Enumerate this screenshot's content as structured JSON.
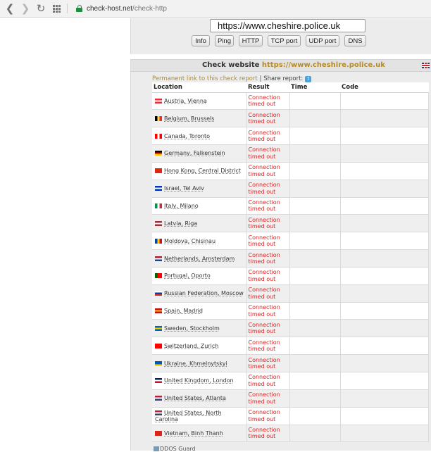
{
  "browser": {
    "url_domain": "check-host.net",
    "url_path": "/check-http"
  },
  "form": {
    "url_value": "https://www.cheshire.police.uk",
    "tabs": [
      {
        "label": "Info",
        "w": 26
      },
      {
        "label": "Ping",
        "w": 27
      },
      {
        "label": "HTTP",
        "w": 34
      },
      {
        "label": "TCP port",
        "w": 47
      },
      {
        "label": "UDP port",
        "w": 48
      },
      {
        "label": "DNS",
        "w": 31
      }
    ]
  },
  "results": {
    "title_prefix": "Check website",
    "title_url": "https://www.cheshire.police.uk",
    "permanent_link": "Permanent link to this check report",
    "share_label": "| Share report:",
    "columns": [
      "Location",
      "Result",
      "Time",
      "Code"
    ],
    "rows": [
      {
        "location": "Austria, Vienna",
        "flag": [
          "#ed2939",
          "#ffffff",
          "#ed2939"
        ],
        "flag_dir": "h",
        "result": "Connection timed out"
      },
      {
        "location": "Belgium, Brussels",
        "flag": [
          "#000000",
          "#fae042",
          "#ed2939"
        ],
        "flag_dir": "v",
        "result": "Connection timed out"
      },
      {
        "location": "Canada, Toronto",
        "flag": [
          "#ff0000",
          "#ffffff",
          "#ff0000"
        ],
        "flag_dir": "v",
        "result": "Connection timed out"
      },
      {
        "location": "Germany, Falkenstein",
        "flag": [
          "#000000",
          "#dd0000",
          "#ffce00"
        ],
        "flag_dir": "h",
        "result": "Connection timed out"
      },
      {
        "location": "Hong Kong, Central District",
        "flag": [
          "#de2910",
          "#de2910",
          "#de2910"
        ],
        "flag_dir": "h",
        "result": "Connection timed out"
      },
      {
        "location": "Israel, Tel Aviv",
        "flag": [
          "#0038b8",
          "#ffffff",
          "#0038b8"
        ],
        "flag_dir": "h",
        "result": "Connection timed out"
      },
      {
        "location": "Italy, Milano",
        "flag": [
          "#009246",
          "#ffffff",
          "#ce2b37"
        ],
        "flag_dir": "v",
        "result": "Connection timed out"
      },
      {
        "location": "Latvia, Riga",
        "flag": [
          "#9e3039",
          "#ffffff",
          "#9e3039"
        ],
        "flag_dir": "h",
        "result": "Connection timed out"
      },
      {
        "location": "Moldova, Chisinau",
        "flag": [
          "#0046ae",
          "#ffd200",
          "#cc092f"
        ],
        "flag_dir": "v",
        "result": "Connection timed out"
      },
      {
        "location": "Netherlands, Amsterdam",
        "flag": [
          "#ae1c28",
          "#ffffff",
          "#21468b"
        ],
        "flag_dir": "h",
        "result": "Connection timed out"
      },
      {
        "location": "Portugal, Oporto",
        "flag": [
          "#006600",
          "#ff0000",
          "#ff0000"
        ],
        "flag_dir": "v",
        "result": "Connection timed out"
      },
      {
        "location": "Russian Federation, Moscow",
        "flag": [
          "#ffffff",
          "#0039a6",
          "#d52b1e"
        ],
        "flag_dir": "h",
        "result": "Connection timed out"
      },
      {
        "location": "Spain, Madrid",
        "flag": [
          "#c60b1e",
          "#ffc400",
          "#c60b1e"
        ],
        "flag_dir": "h",
        "result": "Connection timed out"
      },
      {
        "location": "Sweden, Stockholm",
        "flag": [
          "#006aa7",
          "#fecc00",
          "#006aa7"
        ],
        "flag_dir": "h",
        "result": "Connection timed out"
      },
      {
        "location": "Switzerland, Zurich",
        "flag": [
          "#ff0000",
          "#ff0000",
          "#ff0000"
        ],
        "flag_dir": "h",
        "result": "Connection timed out"
      },
      {
        "location": "Ukraine, Khmelnytskyi",
        "flag": [
          "#0057b7",
          "#0057b7",
          "#ffd700"
        ],
        "flag_dir": "h",
        "result": "Connection timed out"
      },
      {
        "location": "United Kingdom, London",
        "flag": [
          "#012169",
          "#ffffff",
          "#c8102e"
        ],
        "flag_dir": "h",
        "result": "Connection timed out"
      },
      {
        "location": "United States, Atlanta",
        "flag": [
          "#b22234",
          "#ffffff",
          "#3c3b6e"
        ],
        "flag_dir": "h",
        "result": "Connection timed out"
      },
      {
        "location": "United States, North Carolina",
        "flag": [
          "#b22234",
          "#ffffff",
          "#3c3b6e"
        ],
        "flag_dir": "h",
        "result": "Connection timed out"
      },
      {
        "location": "Vietnam, Binh Thanh",
        "flag": [
          "#da251d",
          "#da251d",
          "#da251d"
        ],
        "flag_dir": "h",
        "result": "Connection timed out"
      }
    ]
  },
  "footer": {
    "ddos_label": "DDOS Guard"
  }
}
